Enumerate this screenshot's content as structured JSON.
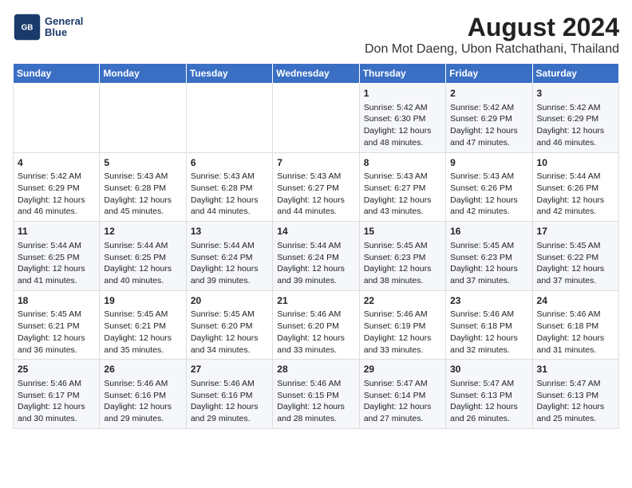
{
  "header": {
    "logo_line1": "General",
    "logo_line2": "Blue",
    "main_title": "August 2024",
    "sub_title": "Don Mot Daeng, Ubon Ratchathani, Thailand"
  },
  "weekdays": [
    "Sunday",
    "Monday",
    "Tuesday",
    "Wednesday",
    "Thursday",
    "Friday",
    "Saturday"
  ],
  "weeks": [
    [
      {
        "day": "",
        "info": ""
      },
      {
        "day": "",
        "info": ""
      },
      {
        "day": "",
        "info": ""
      },
      {
        "day": "",
        "info": ""
      },
      {
        "day": "1",
        "info": "Sunrise: 5:42 AM\nSunset: 6:30 PM\nDaylight: 12 hours and 48 minutes."
      },
      {
        "day": "2",
        "info": "Sunrise: 5:42 AM\nSunset: 6:29 PM\nDaylight: 12 hours and 47 minutes."
      },
      {
        "day": "3",
        "info": "Sunrise: 5:42 AM\nSunset: 6:29 PM\nDaylight: 12 hours and 46 minutes."
      }
    ],
    [
      {
        "day": "4",
        "info": "Sunrise: 5:42 AM\nSunset: 6:29 PM\nDaylight: 12 hours and 46 minutes."
      },
      {
        "day": "5",
        "info": "Sunrise: 5:43 AM\nSunset: 6:28 PM\nDaylight: 12 hours and 45 minutes."
      },
      {
        "day": "6",
        "info": "Sunrise: 5:43 AM\nSunset: 6:28 PM\nDaylight: 12 hours and 44 minutes."
      },
      {
        "day": "7",
        "info": "Sunrise: 5:43 AM\nSunset: 6:27 PM\nDaylight: 12 hours and 44 minutes."
      },
      {
        "day": "8",
        "info": "Sunrise: 5:43 AM\nSunset: 6:27 PM\nDaylight: 12 hours and 43 minutes."
      },
      {
        "day": "9",
        "info": "Sunrise: 5:43 AM\nSunset: 6:26 PM\nDaylight: 12 hours and 42 minutes."
      },
      {
        "day": "10",
        "info": "Sunrise: 5:44 AM\nSunset: 6:26 PM\nDaylight: 12 hours and 42 minutes."
      }
    ],
    [
      {
        "day": "11",
        "info": "Sunrise: 5:44 AM\nSunset: 6:25 PM\nDaylight: 12 hours and 41 minutes."
      },
      {
        "day": "12",
        "info": "Sunrise: 5:44 AM\nSunset: 6:25 PM\nDaylight: 12 hours and 40 minutes."
      },
      {
        "day": "13",
        "info": "Sunrise: 5:44 AM\nSunset: 6:24 PM\nDaylight: 12 hours and 39 minutes."
      },
      {
        "day": "14",
        "info": "Sunrise: 5:44 AM\nSunset: 6:24 PM\nDaylight: 12 hours and 39 minutes."
      },
      {
        "day": "15",
        "info": "Sunrise: 5:45 AM\nSunset: 6:23 PM\nDaylight: 12 hours and 38 minutes."
      },
      {
        "day": "16",
        "info": "Sunrise: 5:45 AM\nSunset: 6:23 PM\nDaylight: 12 hours and 37 minutes."
      },
      {
        "day": "17",
        "info": "Sunrise: 5:45 AM\nSunset: 6:22 PM\nDaylight: 12 hours and 37 minutes."
      }
    ],
    [
      {
        "day": "18",
        "info": "Sunrise: 5:45 AM\nSunset: 6:21 PM\nDaylight: 12 hours and 36 minutes."
      },
      {
        "day": "19",
        "info": "Sunrise: 5:45 AM\nSunset: 6:21 PM\nDaylight: 12 hours and 35 minutes."
      },
      {
        "day": "20",
        "info": "Sunrise: 5:45 AM\nSunset: 6:20 PM\nDaylight: 12 hours and 34 minutes."
      },
      {
        "day": "21",
        "info": "Sunrise: 5:46 AM\nSunset: 6:20 PM\nDaylight: 12 hours and 33 minutes."
      },
      {
        "day": "22",
        "info": "Sunrise: 5:46 AM\nSunset: 6:19 PM\nDaylight: 12 hours and 33 minutes."
      },
      {
        "day": "23",
        "info": "Sunrise: 5:46 AM\nSunset: 6:18 PM\nDaylight: 12 hours and 32 minutes."
      },
      {
        "day": "24",
        "info": "Sunrise: 5:46 AM\nSunset: 6:18 PM\nDaylight: 12 hours and 31 minutes."
      }
    ],
    [
      {
        "day": "25",
        "info": "Sunrise: 5:46 AM\nSunset: 6:17 PM\nDaylight: 12 hours and 30 minutes."
      },
      {
        "day": "26",
        "info": "Sunrise: 5:46 AM\nSunset: 6:16 PM\nDaylight: 12 hours and 29 minutes."
      },
      {
        "day": "27",
        "info": "Sunrise: 5:46 AM\nSunset: 6:16 PM\nDaylight: 12 hours and 29 minutes."
      },
      {
        "day": "28",
        "info": "Sunrise: 5:46 AM\nSunset: 6:15 PM\nDaylight: 12 hours and 28 minutes."
      },
      {
        "day": "29",
        "info": "Sunrise: 5:47 AM\nSunset: 6:14 PM\nDaylight: 12 hours and 27 minutes."
      },
      {
        "day": "30",
        "info": "Sunrise: 5:47 AM\nSunset: 6:13 PM\nDaylight: 12 hours and 26 minutes."
      },
      {
        "day": "31",
        "info": "Sunrise: 5:47 AM\nSunset: 6:13 PM\nDaylight: 12 hours and 25 minutes."
      }
    ]
  ]
}
